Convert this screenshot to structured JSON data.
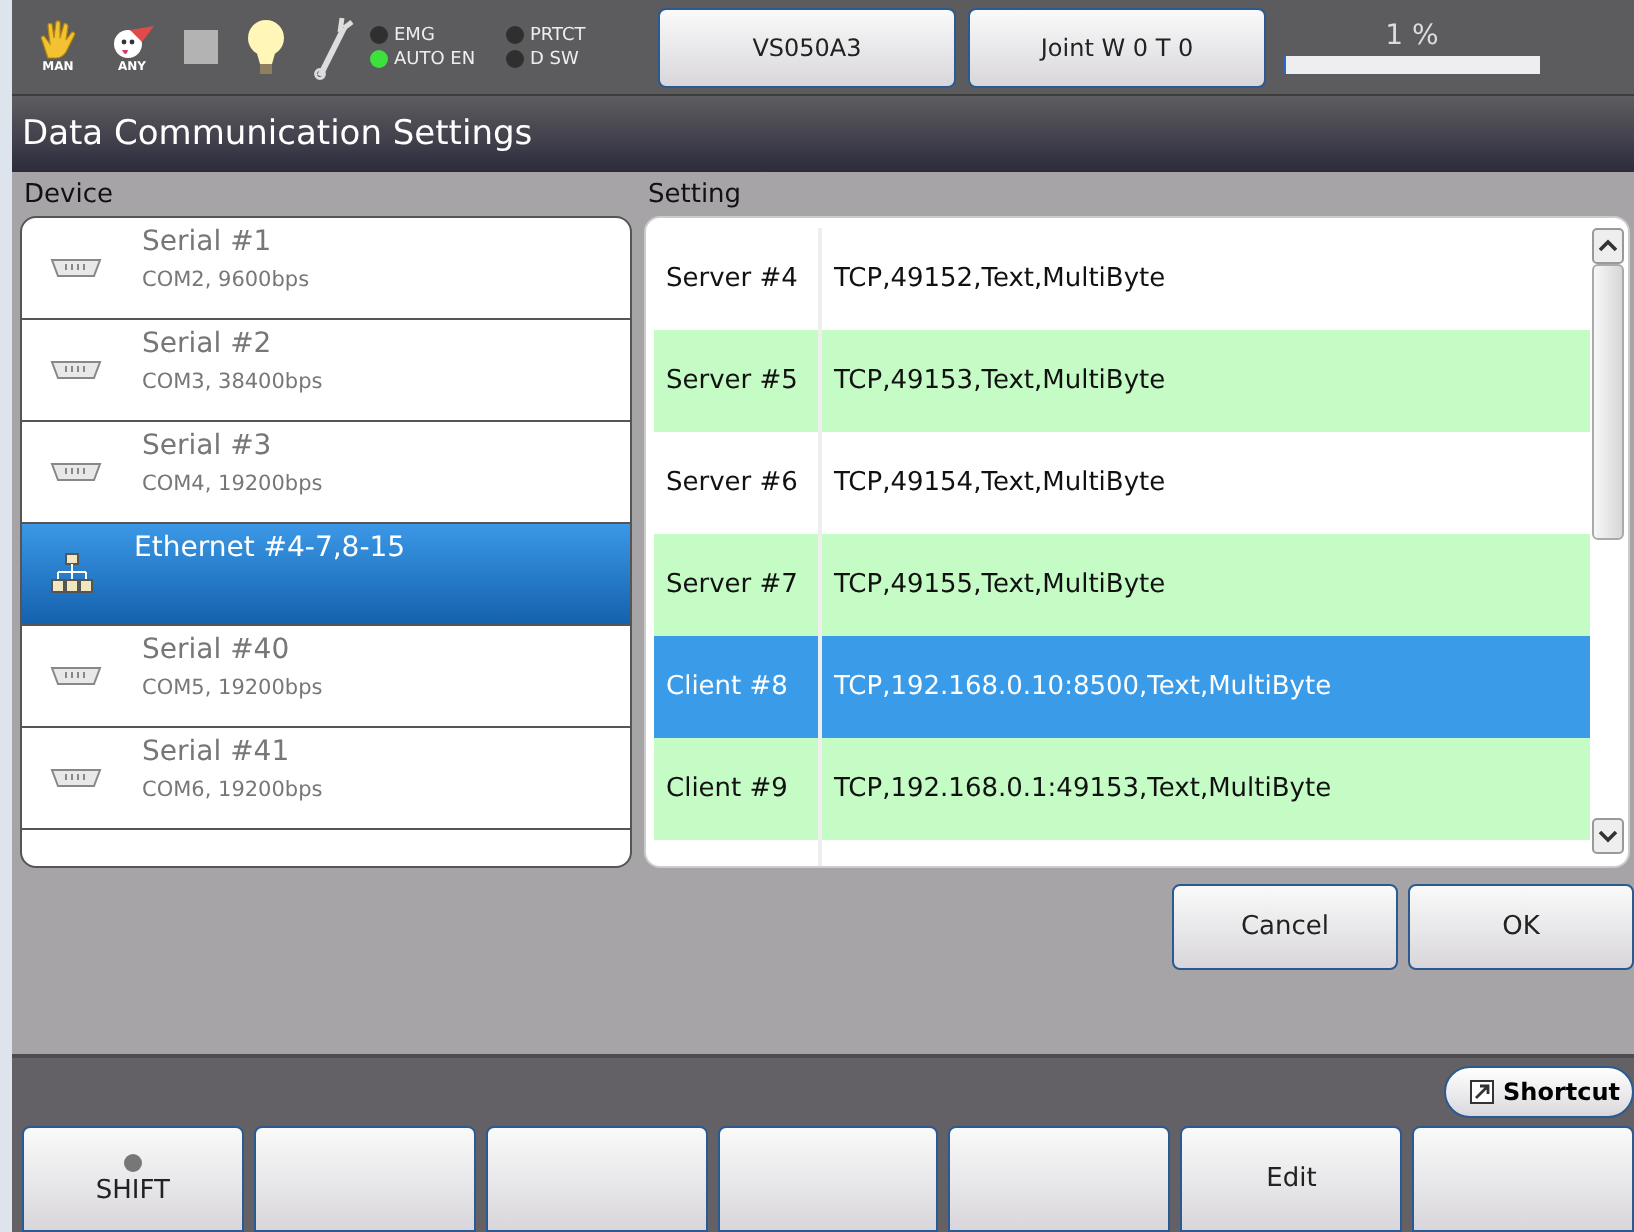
{
  "status_bar": {
    "mode_icons": [
      {
        "label": "MAN"
      },
      {
        "label": "ANY"
      }
    ],
    "indicators": [
      {
        "label": "EMG",
        "on": false
      },
      {
        "label": "PRTCT",
        "on": false
      },
      {
        "label": "AUTO EN",
        "on": true
      },
      {
        "label": "D SW",
        "on": false
      }
    ],
    "robot_button": "VS050A3",
    "coordinate_button": "Joint W 0 T 0",
    "speed": {
      "reading": "1 %",
      "level": 0.01
    }
  },
  "window": {
    "title": "Data Communication Settings"
  },
  "device_list": {
    "heading": "Device",
    "items": [
      {
        "kind": "serial",
        "name": "Serial #1",
        "detail": "COM2, 9600bps",
        "selected": false
      },
      {
        "kind": "serial",
        "name": "Serial #2",
        "detail": "COM3, 38400bps",
        "selected": false
      },
      {
        "kind": "serial",
        "name": "Serial #3",
        "detail": "COM4, 19200bps",
        "selected": false
      },
      {
        "kind": "ethernet",
        "name": "Ethernet #4-7,8-15",
        "selected": true
      },
      {
        "kind": "serial",
        "name": "Serial #40",
        "detail": "COM5, 19200bps",
        "selected": false
      },
      {
        "kind": "serial",
        "name": "Serial #41",
        "detail": "COM6, 19200bps",
        "selected": false
      }
    ]
  },
  "setting_list": {
    "heading": "Setting",
    "rows": [
      {
        "name": "Server #4",
        "value": "TCP,49152,Text,MultiByte",
        "selected": false
      },
      {
        "name": "Server #5",
        "value": "TCP,49153,Text,MultiByte",
        "selected": false
      },
      {
        "name": "Server #6",
        "value": "TCP,49154,Text,MultiByte",
        "selected": false
      },
      {
        "name": "Server #7",
        "value": "TCP,49155,Text,MultiByte",
        "selected": false
      },
      {
        "name": "Client #8",
        "value": "TCP,192.168.0.10:8500,Text,MultiByte",
        "selected": true
      },
      {
        "name": "Client #9",
        "value": "TCP,192.168.0.1:49153,Text,MultiByte",
        "selected": false
      }
    ]
  },
  "dialog_buttons": [
    "Cancel",
    "OK"
  ],
  "shortcut_button": "Shortcut",
  "function_keys": [
    {
      "kind": "lamp",
      "label": "SHIFT",
      "lamp_on": false
    },
    {
      "kind": "blank"
    },
    {
      "kind": "blank"
    },
    {
      "kind": "blank"
    },
    {
      "kind": "blank"
    },
    {
      "kind": "text",
      "label": "Edit"
    },
    {
      "kind": "blank"
    }
  ]
}
